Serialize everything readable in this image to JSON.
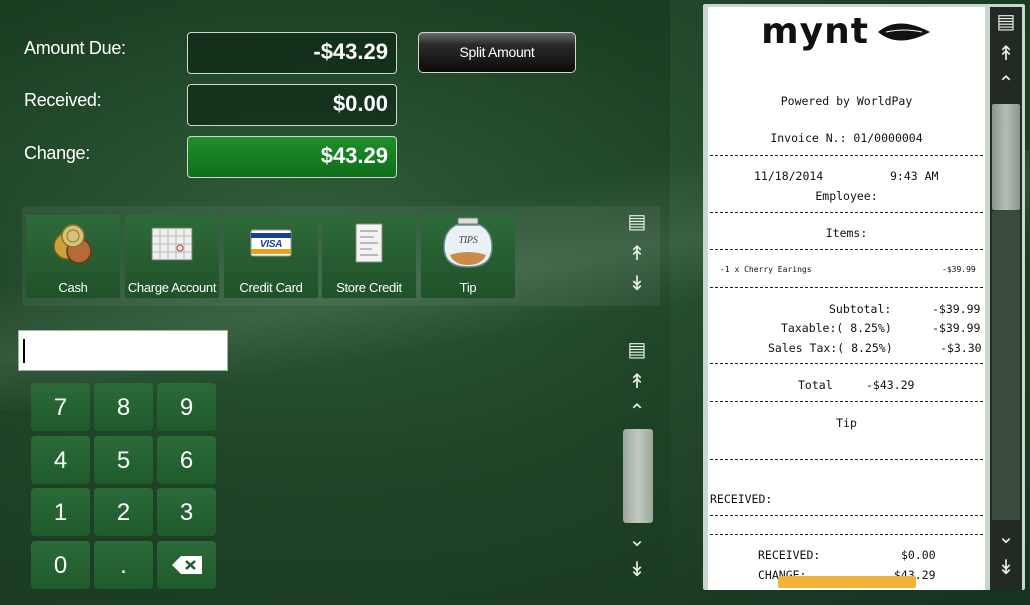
{
  "amounts": {
    "due_label": "Amount Due:",
    "due_value": "-$43.29",
    "received_label": "Received:",
    "received_value": "$0.00",
    "change_label": "Change:",
    "change_value": "$43.29"
  },
  "split_button": "Split Amount",
  "tenders": [
    {
      "label": "Cash",
      "icon": "coins-icon"
    },
    {
      "label": "Charge Account",
      "icon": "calendar-icon"
    },
    {
      "label": "Credit Card",
      "icon": "visa-card-icon",
      "badge": "VISA"
    },
    {
      "label": "Store Credit",
      "icon": "receipt-icon"
    },
    {
      "label": "Tip",
      "icon": "tip-jar-icon",
      "badge": "TIPS"
    }
  ],
  "entry": {
    "value": ""
  },
  "keypad": [
    "7",
    "8",
    "9",
    "4",
    "5",
    "6",
    "1",
    "2",
    "3",
    "0",
    "."
  ],
  "receipt": {
    "brand": "mynt",
    "powered_by": "Powered by WorldPay",
    "invoice": "Invoice N.: 01/0000004",
    "date": "11/18/2014",
    "time": "9:43 AM",
    "employee": "Employee:",
    "items_header": "Items:",
    "item_line": "-1 x Cherry Earings",
    "item_price": "-$39.99",
    "subtotal_label": "Subtotal:",
    "subtotal_value": "-$39.99",
    "taxable_label": "Taxable:( 8.25%)",
    "taxable_value": "-$39.99",
    "salestax_label": "Sales Tax:( 8.25%)",
    "salestax_value": "-$3.30",
    "total_label": "Total",
    "total_value": "-$43.29",
    "tip_label": "Tip",
    "received_header": "RECEIVED:",
    "received_label": "RECEIVED:",
    "received_value": "$0.00",
    "change_label": "CHANGE:",
    "change_value": "$43.29"
  },
  "colors": {
    "accent_green": "#1e8f2a",
    "tile_green": "#2c6a38",
    "highlight": "#f2b33d"
  }
}
